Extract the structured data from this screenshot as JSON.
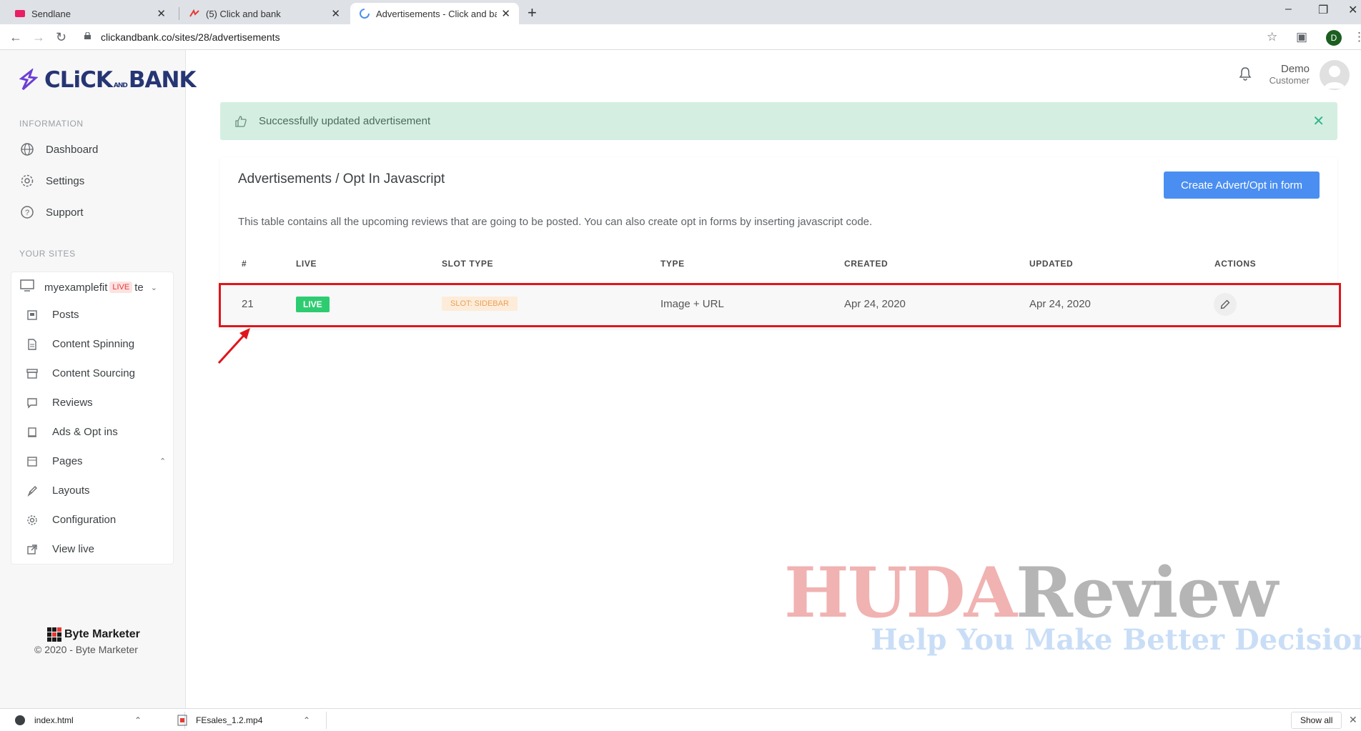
{
  "browser": {
    "tabs": [
      {
        "title": "Sendlane",
        "active": false
      },
      {
        "title": "(5) Click and bank",
        "active": false
      },
      {
        "title": "Advertisements - Click and bank",
        "active": true
      }
    ],
    "url": "clickandbank.co/sites/28/advertisements",
    "profile_initial": "D"
  },
  "brand": {
    "logo_main": "CLiCK",
    "logo_and": "AND",
    "logo_end": "BANK",
    "footer_brand": "Byte Marketer",
    "footer_copy": "© 2020 - Byte Marketer"
  },
  "sidebar": {
    "information_title": "INFORMATION",
    "information_items": [
      {
        "label": "Dashboard",
        "icon": "globe-icon"
      },
      {
        "label": "Settings",
        "icon": "gear-icon"
      },
      {
        "label": "Support",
        "icon": "help-icon"
      }
    ],
    "sites_title": "YOUR SITES",
    "site": {
      "name_start": "myexamplefit",
      "live": "LIVE",
      "name_end": "te"
    },
    "site_items": [
      {
        "label": "Posts",
        "icon": "posts-icon"
      },
      {
        "label": "Content Spinning",
        "icon": "document-icon"
      },
      {
        "label": "Content Sourcing",
        "icon": "archive-icon"
      },
      {
        "label": "Reviews",
        "icon": "comment-icon"
      },
      {
        "label": "Ads & Opt ins",
        "icon": "ad-icon"
      },
      {
        "label": "Pages",
        "icon": "page-icon"
      },
      {
        "label": "Layouts",
        "icon": "brush-icon"
      },
      {
        "label": "Configuration",
        "icon": "gear-icon"
      },
      {
        "label": "View live",
        "icon": "external-link-icon"
      }
    ]
  },
  "header": {
    "user_name": "Demo",
    "user_role": "Customer"
  },
  "alert": {
    "message": "Successfully updated advertisement"
  },
  "card": {
    "title": "Advertisements / Opt In Javascript",
    "create_button": "Create Advert/Opt in form",
    "description": "This table contains all the upcoming reviews that are going to be posted. You can also create opt in forms by inserting javascript code.",
    "columns": [
      "#",
      "LIVE",
      "SLOT TYPE",
      "TYPE",
      "CREATED",
      "UPDATED",
      "ACTIONS"
    ],
    "rows": [
      {
        "id": "21",
        "live": "LIVE",
        "slot_type": "SLOT: SIDEBAR",
        "type": "Image + URL",
        "created": "Apr 24, 2020",
        "updated": "Apr 24, 2020"
      }
    ]
  },
  "watermark": {
    "line1_a": "HUDA",
    "line1_b": "Review",
    "line2": "Help You Make Better Decisions"
  },
  "downloads": {
    "items": [
      "index.html",
      "FEsales_1.2.mp4"
    ],
    "show_all": "Show all"
  },
  "colors": {
    "accent": "#4a8ef1",
    "success_bg": "#d4efe2",
    "live_green": "#2ecc71",
    "highlight_red": "#e0151b"
  }
}
